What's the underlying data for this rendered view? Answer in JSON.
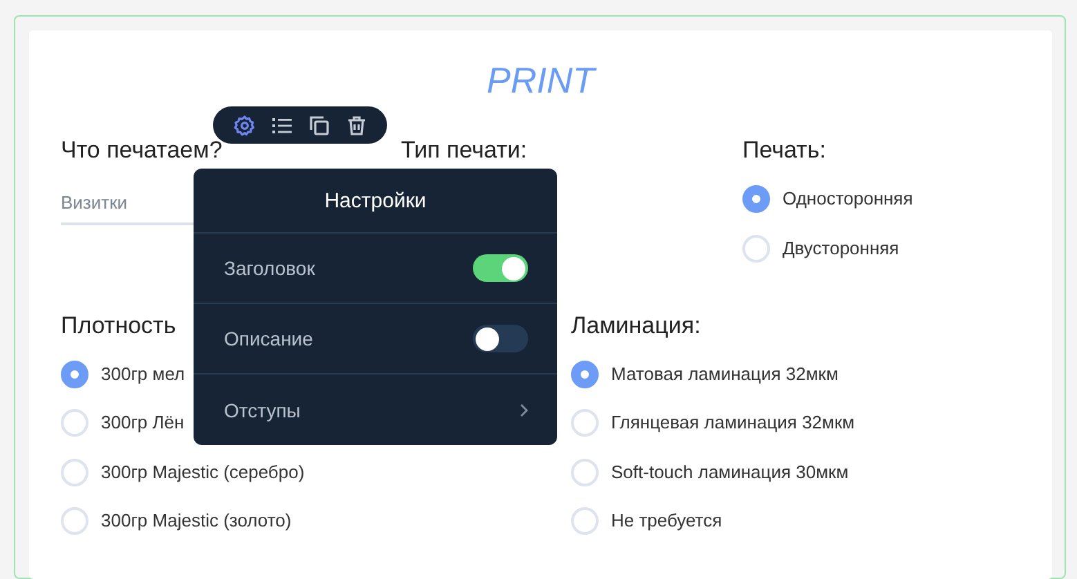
{
  "title": "PRINT",
  "toolbar": [
    {
      "kind": "settings",
      "selected": true
    },
    {
      "kind": "list",
      "selected": false
    },
    {
      "kind": "copy",
      "selected": false
    },
    {
      "kind": "delete",
      "selected": false
    }
  ],
  "fields_row_1": [
    {
      "kind": "text",
      "label": "Что печатаем?",
      "value": "Визитки"
    },
    {
      "kind": "label",
      "label": "Тип печати:"
    },
    {
      "kind": "radio",
      "label": "Печать:",
      "options": [
        {
          "label": "Односторонняя",
          "selected": true
        },
        {
          "label": "Двусторонняя",
          "selected": false
        }
      ]
    }
  ],
  "fields_row_2": [
    {
      "kind": "radio",
      "label": "Плотность",
      "options": [
        {
          "label": "300гр мел",
          "selected": true
        },
        {
          "label": "300гр Лён",
          "selected": false
        },
        {
          "label": "300гр Majestic (серебро)",
          "selected": false
        },
        {
          "label": "300гр Majestic (золото)",
          "selected": false
        }
      ]
    },
    {
      "kind": "radio",
      "label": "Ламинация:",
      "options": [
        {
          "label": "Матовая ламинация 32мкм",
          "selected": true
        },
        {
          "label": "Глянцевая ламинация 32мкм",
          "selected": false
        },
        {
          "label": "Soft-touch ламинация 30мкм",
          "selected": false
        },
        {
          "label": "Не требуется",
          "selected": false
        }
      ]
    }
  ],
  "settings_panel": {
    "title": "Настройки",
    "rows": [
      {
        "kind": "toggle",
        "label": "Заголовок",
        "on": true
      },
      {
        "kind": "toggle",
        "label": "Описание",
        "on": false
      },
      {
        "kind": "submenu",
        "label": "Отступы"
      }
    ]
  }
}
